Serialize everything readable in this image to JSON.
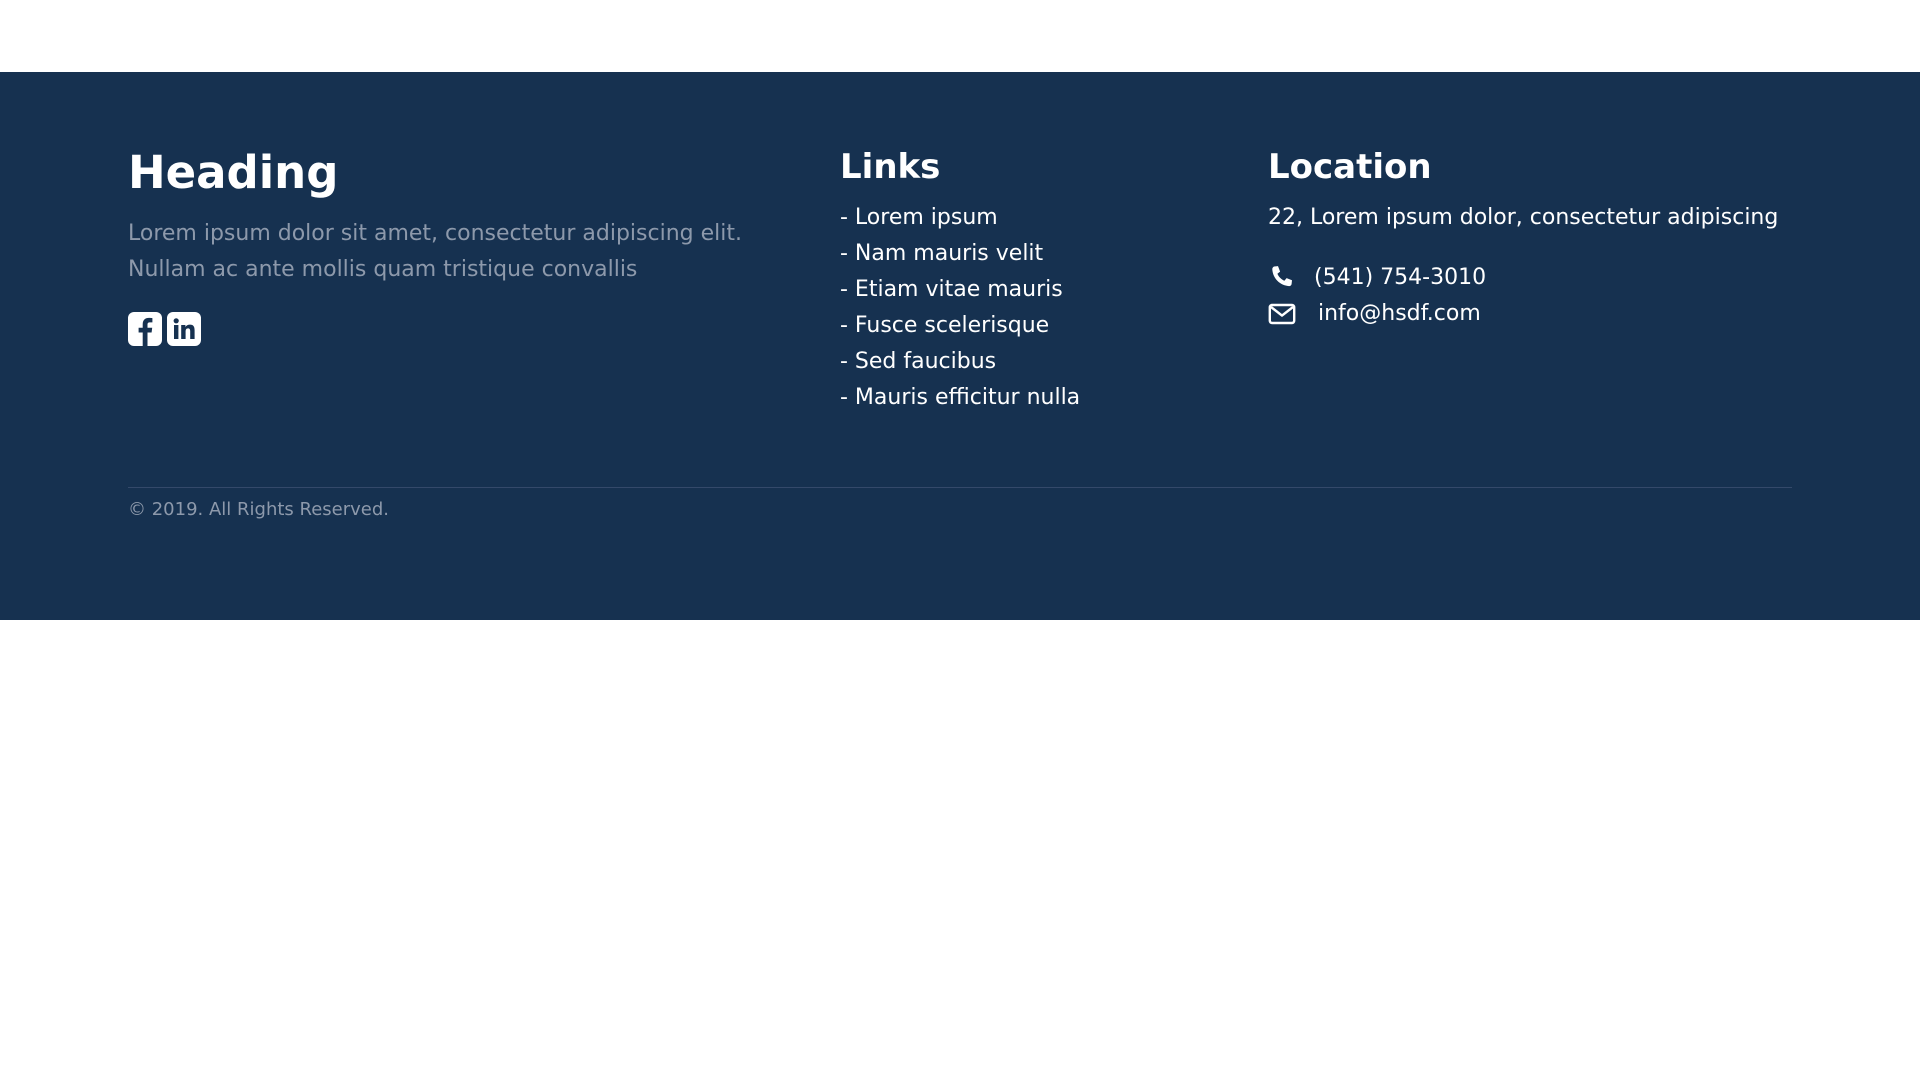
{
  "colors": {
    "footer_bg": "#163150",
    "muted_text": "#8d99ab",
    "text": "#ffffff",
    "divider": "#34496a"
  },
  "about": {
    "heading": "Heading",
    "text_line1": "Lorem ipsum dolor sit amet, consectetur adipiscing elit.",
    "text_line2": "Nullam ac ante mollis quam tristique convallis",
    "social": [
      {
        "icon": "facebook-icon"
      },
      {
        "icon": "linkedin-icon"
      }
    ]
  },
  "links": {
    "title": "Links",
    "items": [
      "- Lorem ipsum",
      "- Nam mauris velit",
      "- Etiam vitae mauris",
      "- Fusce scelerisque",
      "- Sed faucibus",
      "- Mauris efficitur nulla"
    ]
  },
  "location": {
    "title": "Location",
    "address": "22, Lorem ipsum dolor, consectetur adipiscing",
    "phone": "(541) 754-3010",
    "phone_icon": "phone-icon",
    "email": "info@hsdf.com",
    "email_icon": "envelope-icon"
  },
  "footer": {
    "copyright": "© 2019. All Rights Reserved."
  }
}
